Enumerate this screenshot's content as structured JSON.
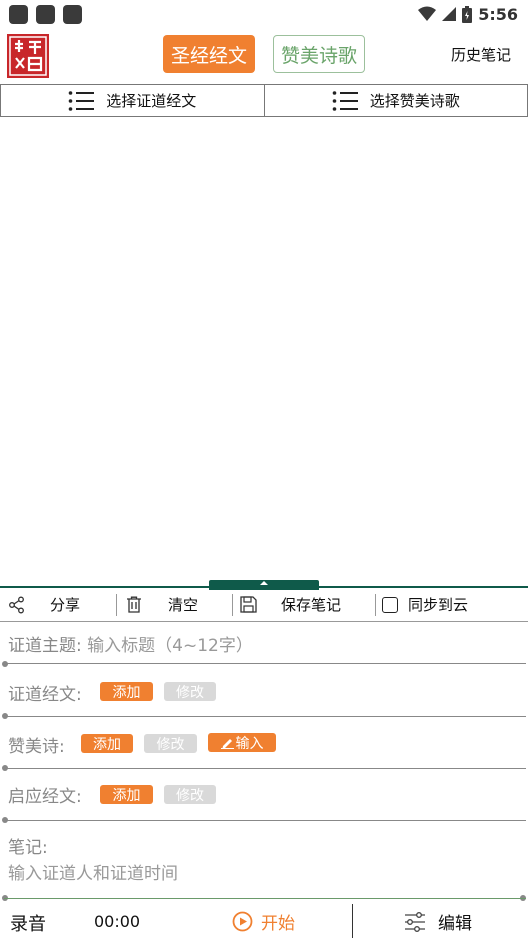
{
  "status_bar": {
    "time": "5:56",
    "icons": [
      "wifi-icon",
      "signal-icon",
      "battery-icon"
    ]
  },
  "header": {
    "logo_icon": "seal-logo-icon",
    "tabs": [
      {
        "label": "圣经经文",
        "active": true
      },
      {
        "label": "赞美诗歌",
        "active": false
      }
    ],
    "history_label": "历史笔记"
  },
  "selectors": {
    "left_label": "选择证道经文",
    "right_label": "选择赞美诗歌"
  },
  "toolbar": {
    "share_label": "分享",
    "clear_label": "清空",
    "save_label": "保存笔记",
    "sync_label": "同步到云",
    "sync_checked": false
  },
  "form": {
    "topic": {
      "label": "证道主题:",
      "placeholder": "输入标题（4~12字）"
    },
    "scripture": {
      "label": "证道经文:",
      "add": "添加",
      "edit": "修改"
    },
    "hymn": {
      "label": "赞美诗:",
      "add": "添加",
      "edit": "修改",
      "input": "输入"
    },
    "response": {
      "label": "启应经文:",
      "add": "添加",
      "edit": "修改"
    },
    "notes": {
      "label": "笔记:",
      "placeholder": "输入证道人和证道时间"
    }
  },
  "recorder": {
    "label": "录音",
    "time": "00:00",
    "start_label": "开始",
    "edit_label": "编辑"
  },
  "colors": {
    "accent": "#f08030",
    "green": "#6aa46a",
    "dark_green": "#0f5a4a"
  }
}
